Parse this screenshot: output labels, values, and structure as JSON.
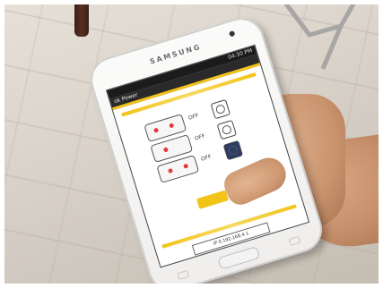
{
  "scene": {
    "description_free": true,
    "colors": {
      "floor": "#dcd5cb",
      "phone_body": "#f4f3f1",
      "screen_accent": "#f2c318",
      "skin": "#c9936e"
    }
  },
  "phone": {
    "brand": "SAMSUNG",
    "status_time": "04:30 PM",
    "app_title": "ok Power",
    "switch_label_1": "OFF",
    "switch_label_2": "OFF",
    "switch_label_3": "OFF",
    "footer_text": "IP 0.192.168.4.1"
  },
  "icons": {
    "clock": "clock-icon",
    "home": "home-button-icon"
  }
}
